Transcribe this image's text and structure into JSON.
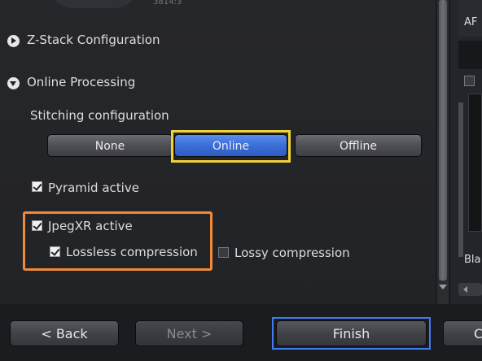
{
  "top_partial_text": "3814:3",
  "sections": {
    "zstack_label": "Z-Stack Configuration",
    "online_label": "Online Processing"
  },
  "stitching": {
    "label": "Stitching configuration",
    "options": [
      "None",
      "Online",
      "Offline"
    ],
    "selected": "Online"
  },
  "checkboxes": {
    "pyramid": {
      "label": "Pyramid active",
      "checked": true
    },
    "jpegxr": {
      "label": "JpegXR active",
      "checked": true
    },
    "lossless": {
      "label": "Lossless compression",
      "checked": true
    },
    "lossy": {
      "label": "Lossy compression",
      "checked": false
    }
  },
  "right_panel": {
    "top_text": "AF",
    "bottom_text": "Bla"
  },
  "footer": {
    "back_label": "< Back",
    "next_label": "Next >",
    "finish_label": "Finish",
    "cancel_partial": "C"
  },
  "highlight_colors": {
    "selection": "#f0d23c",
    "compression_group": "#f08a38",
    "finish": "#3f7cf0"
  }
}
